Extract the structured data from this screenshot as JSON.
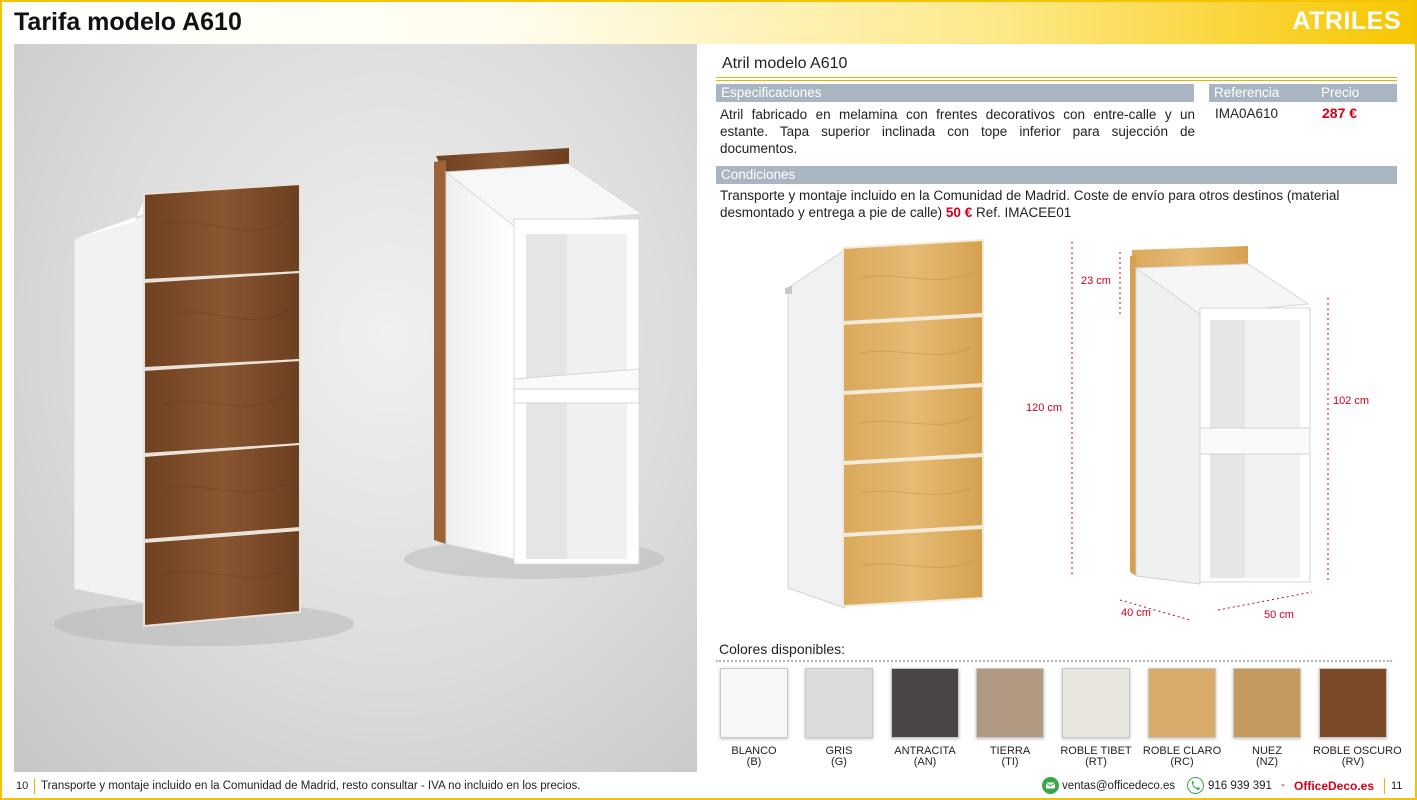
{
  "header": {
    "title": "Tarifa modelo A610",
    "section": "ATRILES"
  },
  "product": {
    "model_title": "Atril modelo A610",
    "specs_label": "Especificaciones",
    "specs_text": "Atril fabricado en melamina con frentes decorativos con entre-calle y un estante. Tapa superior inclinada con tope inferior para sujección de documentos.",
    "reference_label": "Referencia",
    "price_label": "Precio",
    "reference_code": "IMA0A610",
    "price": "287 €"
  },
  "conditions": {
    "label": "Condiciones",
    "text_before": "Transporte y montaje incluido en la Comunidad de Madrid. Coste de envío para otros destinos (material desmontado y entrega a pie de calle)",
    "shipping_price": "50 €",
    "text_after": "Ref. IMACEE01"
  },
  "dimensions": {
    "top": "23 cm",
    "total_height": "120 cm",
    "inner_height": "102 cm",
    "depth": "40 cm",
    "width": "50 cm"
  },
  "colors": {
    "title": "Colores disponibles:",
    "items": [
      {
        "name": "BLANCO",
        "code": "(B)",
        "hex": "#f7f7f7"
      },
      {
        "name": "GRIS",
        "code": "(G)",
        "hex": "#dcdada"
      },
      {
        "name": "ANTRACITA",
        "code": "(AN)",
        "hex": "#4a4546"
      },
      {
        "name": "TIERRA",
        "code": "(TI)",
        "hex": "#b09a82"
      },
      {
        "name": "ROBLE TIBET",
        "code": "(RT)",
        "hex": "#e9e5df"
      },
      {
        "name": "ROBLE CLARO",
        "code": "(RC)",
        "hex": "#d8ac68"
      },
      {
        "name": "NUEZ",
        "code": "(NZ)",
        "hex": "#c49a5e"
      },
      {
        "name": "ROBLE OSCURO",
        "code": "(RV)",
        "hex": "#7a4a28"
      }
    ]
  },
  "footer": {
    "page_left": "10",
    "note": "Transporte y montaje incluido en la Comunidad de Madrid, resto consultar - IVA no incluido en los precios.",
    "email": "ventas@officedeco.es",
    "phone": "916 939 391",
    "dash": "-",
    "brand": "OfficeDeco.es",
    "page_right": "11"
  },
  "theme": {
    "accent": "#f5c400",
    "price_red": "#d0021b",
    "bar_blue": "#a9b6c1"
  }
}
